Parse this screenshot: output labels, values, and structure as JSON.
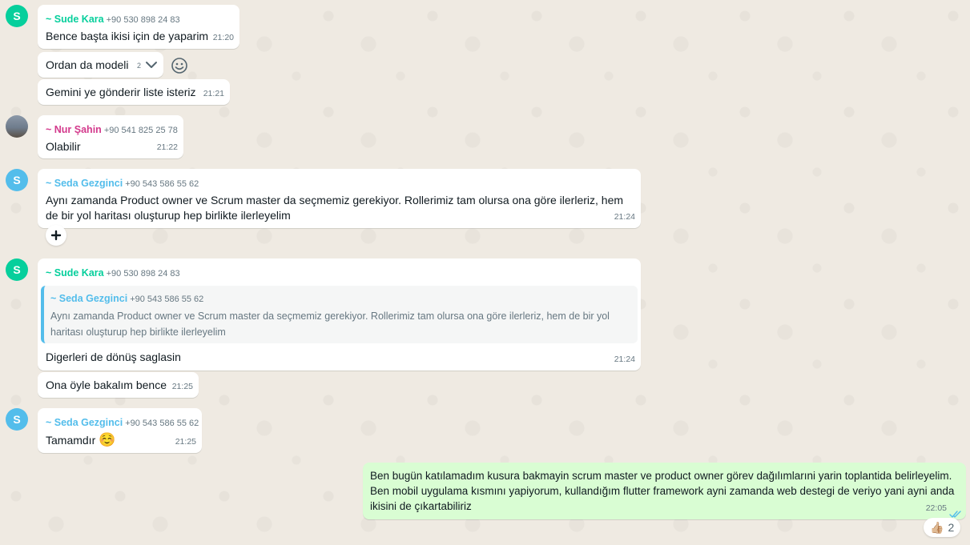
{
  "messages": {
    "m1": {
      "sender": "~ Sude Kara",
      "phone": "+90 530 898 24 83",
      "avatar": "S",
      "text": "Bence başta ikisi için de yaparim",
      "time": "21:20"
    },
    "m2": {
      "text": "Ordan da modeli",
      "time": "2"
    },
    "m3": {
      "text": "Gemini ye gönderir liste isteriz",
      "time": "21:21"
    },
    "m4": {
      "sender": "~ Nur Şahin",
      "phone": "+90 541 825 25 78",
      "text": "Olabilir",
      "time": "21:22"
    },
    "m5": {
      "sender": "~ Seda Gezginci",
      "phone": "+90 543 586 55 62",
      "avatar": "S",
      "text": "Aynı zamanda Product owner ve Scrum master da seçmemiz gerekiyor. Rollerimiz tam olursa ona göre ilerleriz, hem de bir yol haritası oluşturup hep birlikte ilerleyelim",
      "time": "21:24"
    },
    "m6": {
      "sender": "~ Sude Kara",
      "phone": "+90 530 898 24 83",
      "avatar": "S",
      "quote": {
        "sender": "~ Seda Gezginci",
        "phone": "+90 543 586 55 62",
        "text": "Aynı zamanda Product owner ve Scrum master da seçmemiz gerekiyor. Rollerimiz tam olursa ona göre ilerleriz, hem de bir yol haritası oluşturup hep birlikte ilerleyelim"
      },
      "text": "Digerleri de dönüş saglasin",
      "time": "21:24"
    },
    "m7": {
      "text": "Ona öyle bakalım bence",
      "time": "21:25"
    },
    "m8": {
      "sender": "~ Seda Gezginci",
      "phone": "+90 543 586 55 62",
      "avatar": "S",
      "text": "Tamamdır",
      "emoji": "☺️",
      "time": "21:25"
    },
    "m9": {
      "text": "Ben bugün katılamadım kusura bakmayin scrum master ve product owner görev dağılımlarıni yarin toplantida belirleyelim. Ben mobil uygulama kısmını yapiyorum, kullandığım flutter framework ayni zamanda web destegi de veriyo yani ayni anda ikisini de çıkartabiliriz",
      "time": "22:05",
      "reaction_emoji": "👍🏼",
      "reaction_count": "2"
    }
  },
  "icons": {
    "chevron": "chevron-down-icon",
    "emoji_button": "smiley-icon",
    "add_reaction": "plus-icon",
    "read_status": "double-check-icon"
  },
  "colors": {
    "green_name": "#06cf9c",
    "blue_name": "#53bdeb",
    "pink_name": "#d3398c",
    "outgoing_bubble": "#d9fdd3",
    "read_ticks": "#53bdeb"
  }
}
